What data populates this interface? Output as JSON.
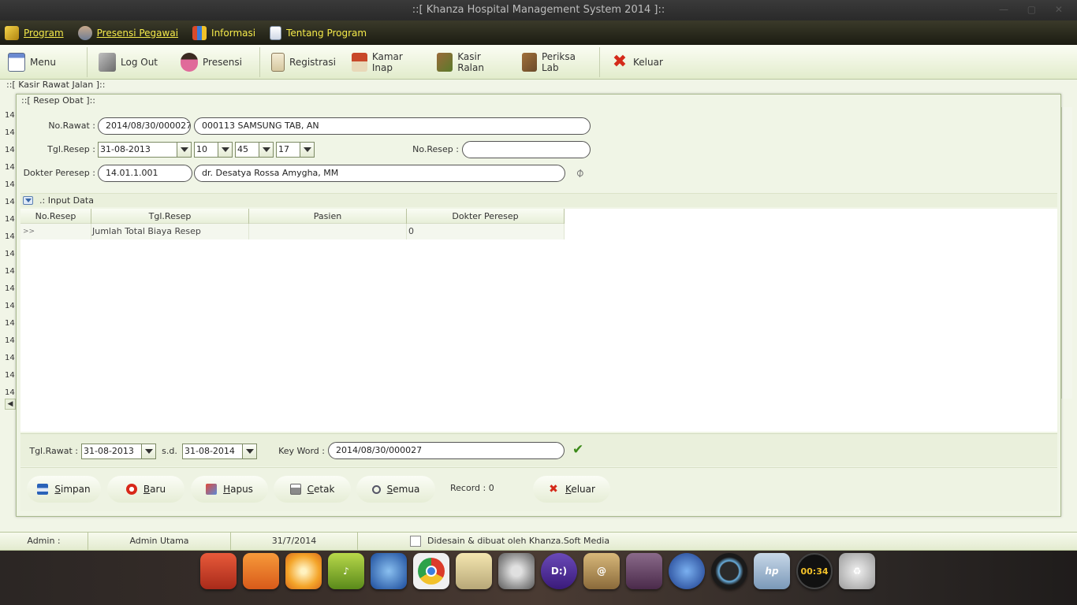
{
  "window": {
    "title": "::[ Khanza Hospital Management System 2014 ]::",
    "controls": "— ▢ ✕"
  },
  "menubar": {
    "items": [
      "Program",
      "Presensi Pegawai",
      "Informasi",
      "Tentang Program"
    ]
  },
  "toolbar": {
    "items": [
      "Menu",
      "Log Out",
      "Presensi",
      "Registrasi",
      "Kamar Inap",
      "Kasir Ralan",
      "Periksa Lab",
      "Keluar"
    ]
  },
  "background": {
    "title": "::[ Kasir Rawat Jalan ]::",
    "row_numbers": [
      "14",
      "14",
      "14",
      "14",
      "14",
      "14",
      "14",
      "14",
      "14",
      "14",
      "14",
      "14",
      "14",
      "14",
      "14",
      "14",
      "14"
    ]
  },
  "dialog": {
    "title": "::[ Resep Obat ]::",
    "form": {
      "no_rawat_label": "No.Rawat :",
      "no_rawat": "2014/08/30/000027",
      "pasien": "000113 SAMSUNG TAB, AN",
      "tgl_resep_label": "Tgl.Resep :",
      "tgl_resep": "31-08-2013",
      "jam": "10",
      "menit": "45",
      "detik": "17",
      "no_resep_label": "No.Resep :",
      "no_resep": "",
      "dokter_label": "Dokter Peresep :",
      "kd_dokter": "14.01.1.001",
      "nm_dokter": "dr. Desatya Rossa Amygha, MM"
    },
    "section_title": ".: Input Data",
    "table": {
      "columns": [
        "No.Resep",
        "Tgl.Resep",
        "Pasien",
        "Dokter Peresep"
      ],
      "rows": [
        [
          ">>",
          "Jumlah Total Biaya Resep",
          "",
          "0"
        ]
      ]
    },
    "filter": {
      "tgl_rawat_label": "Tgl.Rawat :",
      "tgl_dari": "31-08-2013",
      "sd_label": "s.d.",
      "tgl_sampai": "31-08-2014",
      "keyword_label": "Key Word :",
      "keyword": "2014/08/30/000027"
    },
    "buttons": {
      "simpan": "Simpan",
      "baru": "Baru",
      "hapus": "Hapus",
      "cetak": "Cetak",
      "semua": "Semua",
      "record": "Record : 0",
      "keluar": "Keluar"
    }
  },
  "statusbar": {
    "user_label": "Admin :",
    "user": "Admin Utama",
    "date": "31/7/2014",
    "credit": "Didesain & dibuat oleh Khanza.Soft Media"
  },
  "dock": {
    "clock": "00:34",
    "hp": "hp",
    "dplus": "D:)",
    "colors": [
      "#e0452a",
      "#f07a1a",
      "#f4a52a",
      "#9cc42a",
      "#2e6fd0",
      "#ffffff",
      "#d8d0b8",
      "#8a8a8a",
      "#4a2f8a",
      "#c8a26a",
      "#6a4a6a",
      "#2a5ab8",
      "#1a1a1a",
      "#9ab8d8",
      "#101010",
      "#c0c0c0"
    ]
  }
}
